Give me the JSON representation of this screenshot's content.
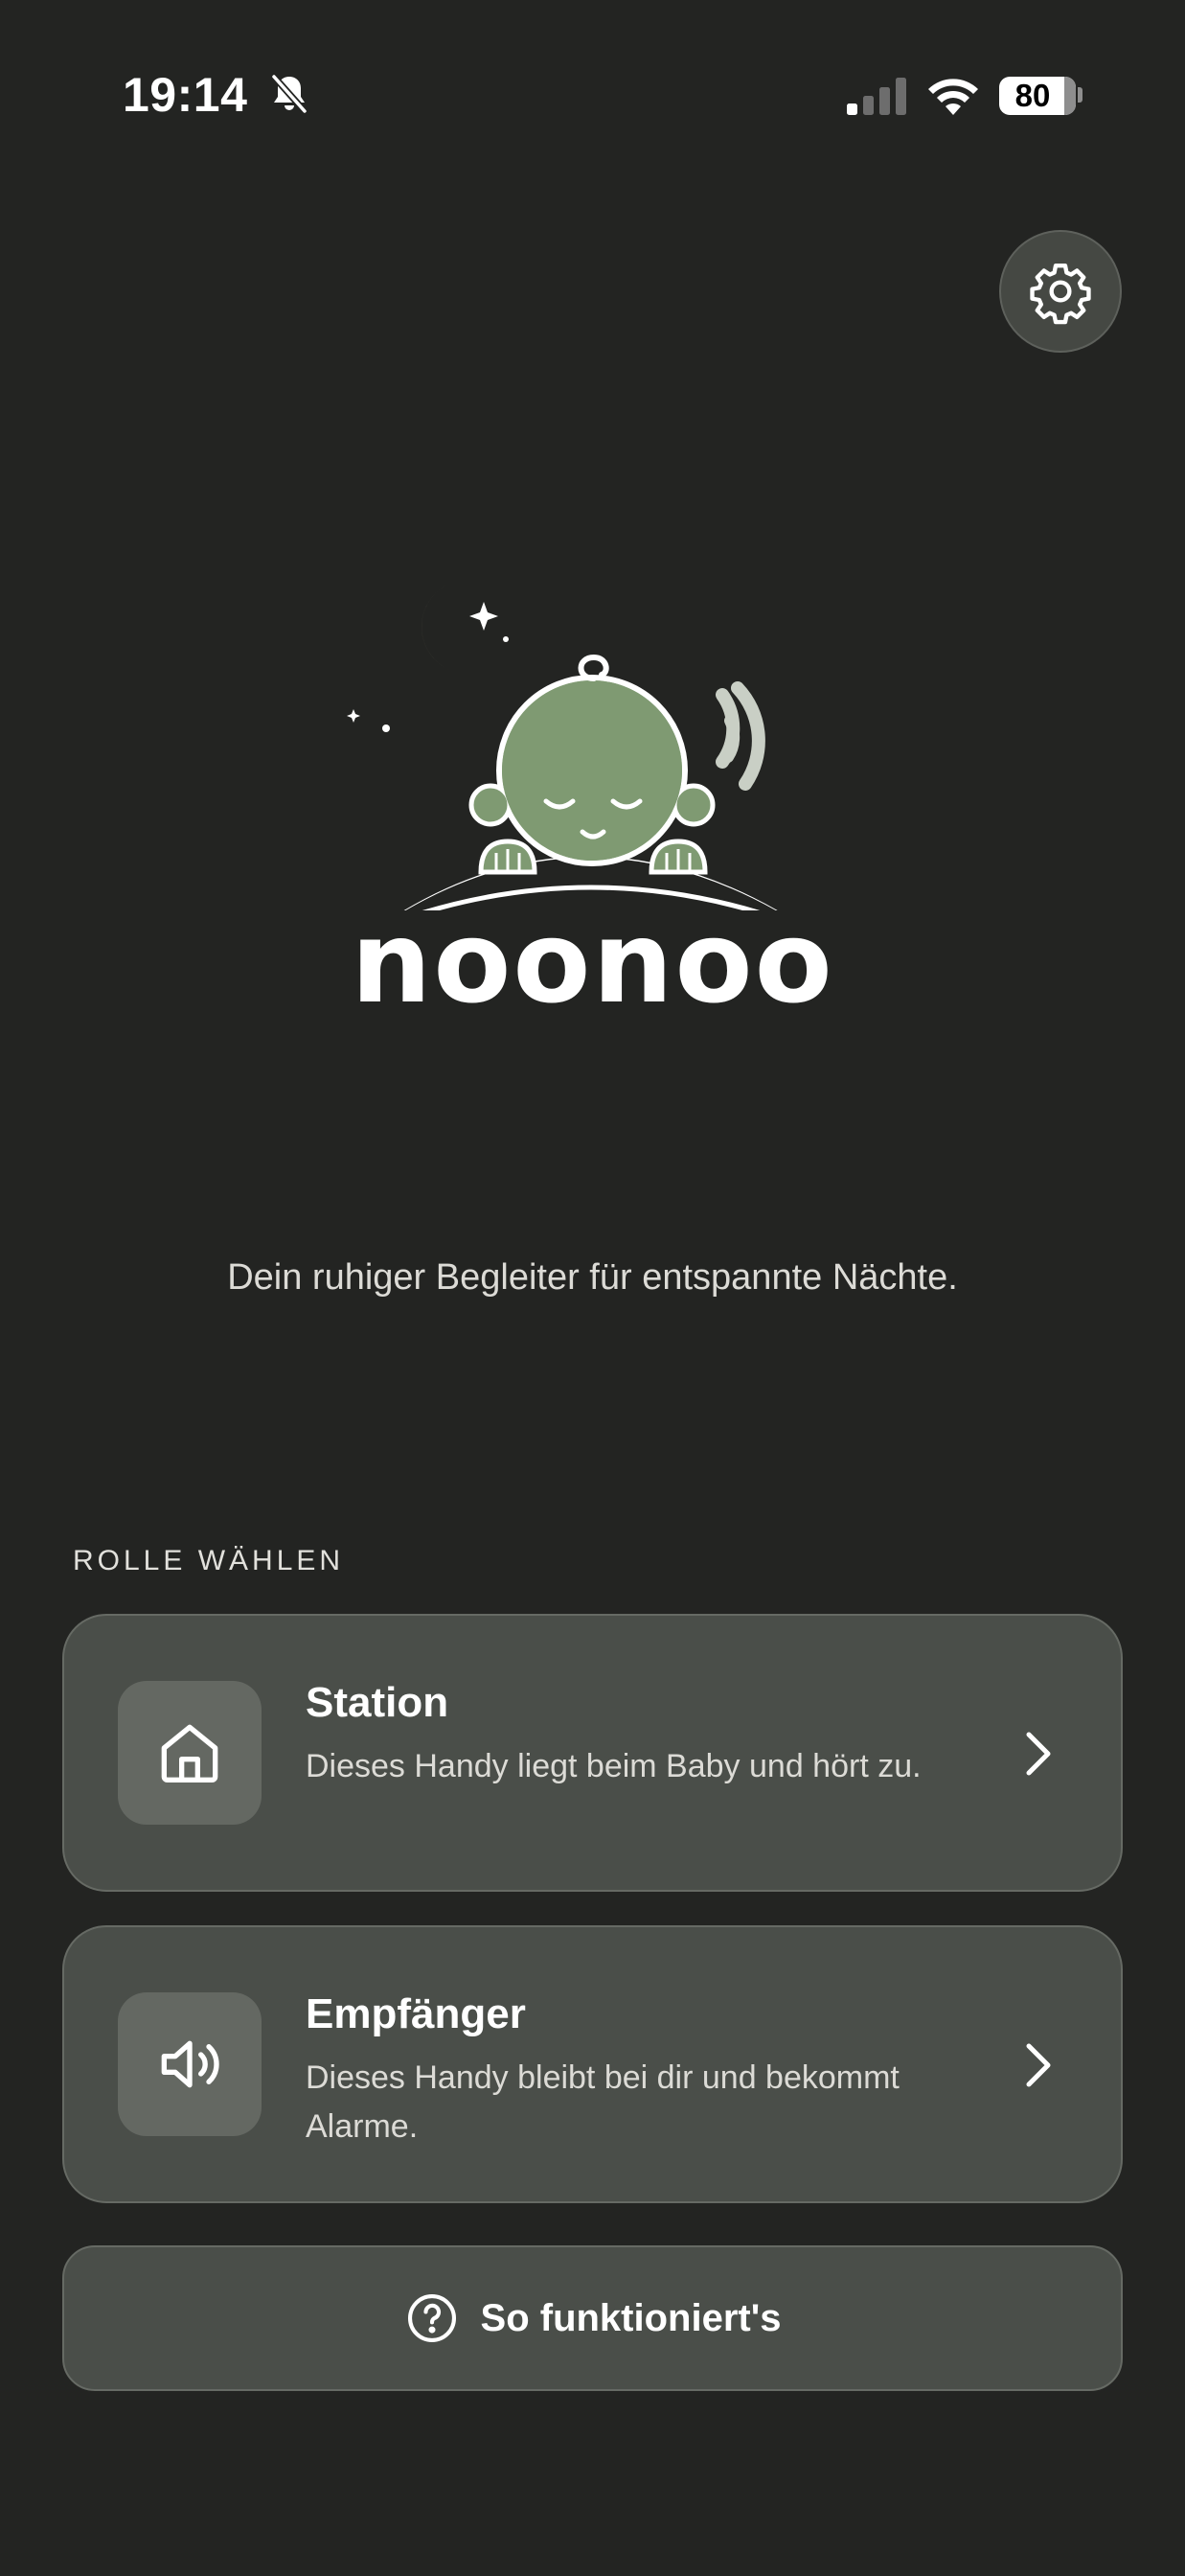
{
  "status_bar": {
    "time": "19:14",
    "battery": "80",
    "icons": [
      "bell-slash-icon",
      "cellular-signal-icon",
      "wifi-icon",
      "battery-icon"
    ]
  },
  "header": {
    "settings_icon": "gear-icon"
  },
  "brand": {
    "name": "noonoo",
    "tagline": "Dein ruhiger Begleiter für entspannte Nächte.",
    "colors": {
      "moon": "#f6e2bd",
      "baby": "#7f9a72",
      "waves": "#c9cfc5"
    }
  },
  "role_section": {
    "label": "ROLLE WÄHLEN",
    "options": [
      {
        "title": "Station",
        "description": "Dieses Handy liegt beim Baby und hört zu.",
        "icon": "home-icon"
      },
      {
        "title": "Empfänger",
        "description": "Dieses Handy bleibt bei dir und bekommt Alarme.",
        "icon": "speaker-icon"
      }
    ]
  },
  "help_button": {
    "label": "So funktioniert's",
    "icon": "question-circle-icon"
  },
  "theme": {
    "background": "#232422",
    "card": "#4a4e49",
    "card_border": "#666a64",
    "text": "#ffffff"
  }
}
